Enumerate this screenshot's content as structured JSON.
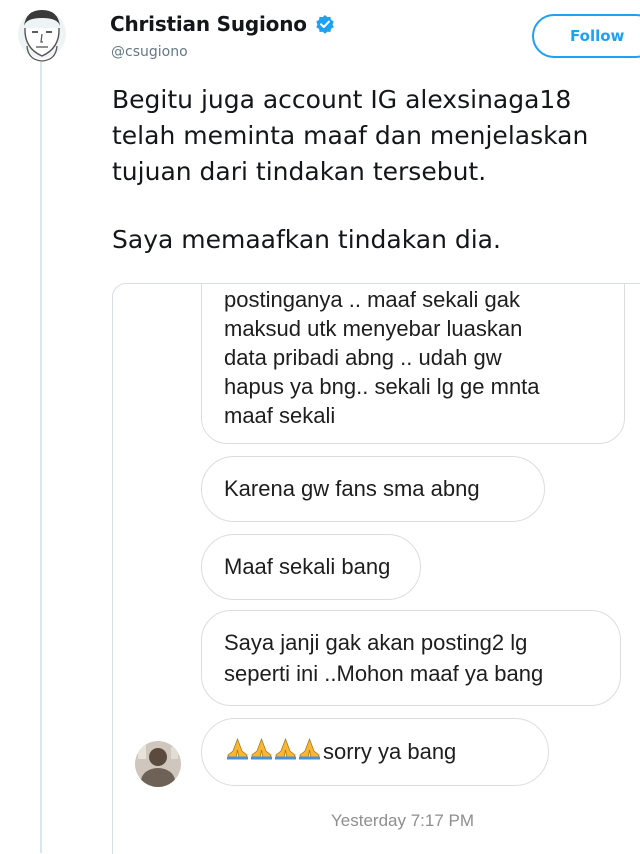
{
  "tweet": {
    "author_name": "Christian Sugiono",
    "handle": "@csugiono",
    "follow_label": "Follow",
    "verified": true,
    "text_lines": [
      "Begitu juga account IG alexsinaga18",
      "telah meminta maaf dan menjelaskan",
      "tujuan dari tindakan tersebut.",
      "Saya memaafkan tindakan dia."
    ]
  },
  "dm_screenshot": {
    "messages": [
      {
        "lines": [
          "postinganya .. maaf sekali gak",
          "maksud utk menyebar luaskan",
          "data pribadi abng .. udah gw",
          "hapus ya bng.. sekali lg  ge mnta",
          "maaf sekali"
        ]
      },
      {
        "lines": [
          "Karena gw fans sma abng"
        ]
      },
      {
        "lines": [
          "Maaf sekali bang"
        ]
      },
      {
        "lines": [
          "Saya janji gak akan posting2 lg",
          "seperti ini ..Mohon maaf ya bang"
        ]
      },
      {
        "emoji": "folded-hands-emoji x4",
        "text": "sorry ya bang"
      }
    ],
    "timestamp": "Yesterday 7:17 PM"
  },
  "colors": {
    "accent": "#1da1f2",
    "handle_gray": "#657786",
    "bubble_border": "#dddddd",
    "timestamp_gray": "#8e8e8e",
    "thread_line": "#d8e6ee"
  },
  "icons": [
    "profile-avatar-cartoon",
    "verified-badge-icon",
    "folded-hands-emoji",
    "dm-sender-avatar"
  ]
}
